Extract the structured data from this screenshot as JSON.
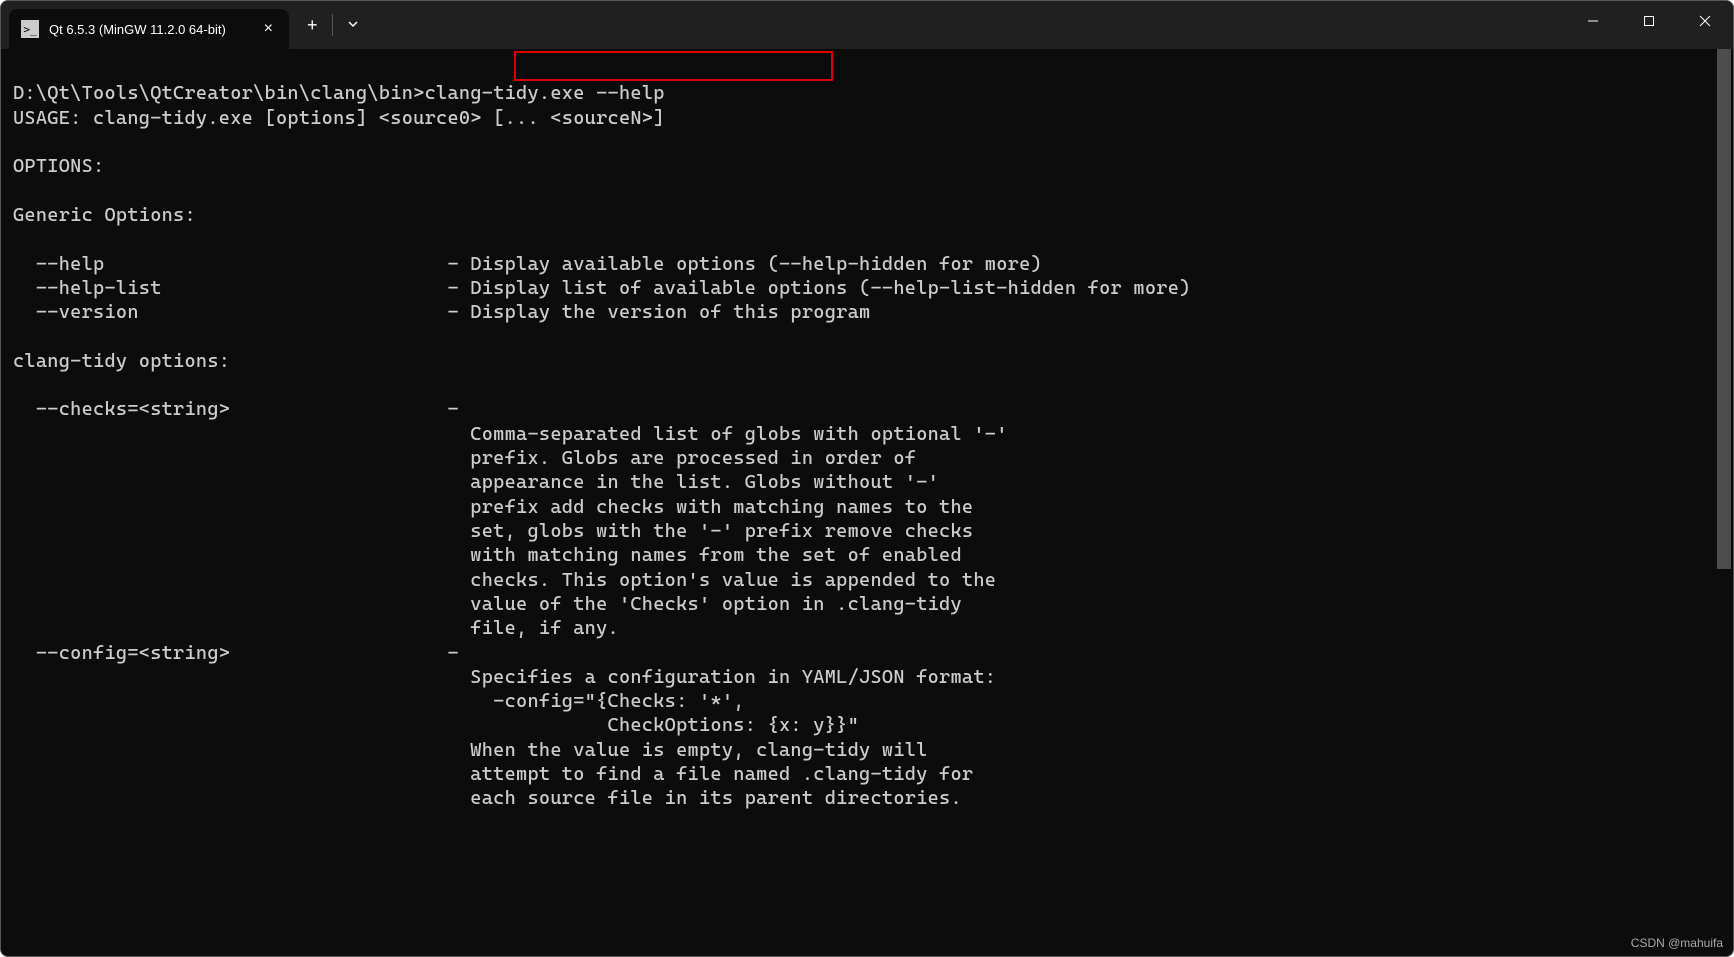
{
  "titlebar": {
    "tab": {
      "icon_label": ">_",
      "title": "Qt 6.5.3 (MinGW 11.2.0 64-bit)",
      "close": "×"
    },
    "new_tab": "+",
    "dropdown": "∨"
  },
  "terminal": {
    "prompt_path": "D:\\Qt\\Tools\\QtCreator\\bin\\clang\\bin>",
    "command": "clang-tidy.exe --help",
    "usage": "USAGE: clang-tidy.exe [options] <source0> [... <sourceN>]",
    "options_header": "OPTIONS:",
    "generic_header": "Generic Options:",
    "opt_help": "  --help                              - Display available options (--help-hidden for more)",
    "opt_help_list": "  --help-list                         - Display list of available options (--help-list-hidden for more)",
    "opt_version": "  --version                           - Display the version of this program",
    "clang_header": "clang-tidy options:",
    "opt_checks": "  --checks=<string>                   -",
    "checks_l1": "                                        Comma-separated list of globs with optional '-'",
    "checks_l2": "                                        prefix. Globs are processed in order of",
    "checks_l3": "                                        appearance in the list. Globs without '-'",
    "checks_l4": "                                        prefix add checks with matching names to the",
    "checks_l5": "                                        set, globs with the '-' prefix remove checks",
    "checks_l6": "                                        with matching names from the set of enabled",
    "checks_l7": "                                        checks. This option's value is appended to the",
    "checks_l8": "                                        value of the 'Checks' option in .clang-tidy",
    "checks_l9": "                                        file, if any.",
    "opt_config": "  --config=<string>                   -",
    "config_l1": "                                        Specifies a configuration in YAML/JSON format:",
    "config_l2": "                                          -config=\"{Checks: '*',",
    "config_l3": "                                                    CheckOptions: {x: y}}\"",
    "config_l4": "                                        When the value is empty, clang-tidy will",
    "config_l5": "                                        attempt to find a file named .clang-tidy for",
    "config_l6": "                                        each source file in its parent directories."
  },
  "highlight": {
    "left": "513",
    "top": "2",
    "width": "319",
    "height": "30"
  },
  "watermark": "CSDN @mahuifa"
}
